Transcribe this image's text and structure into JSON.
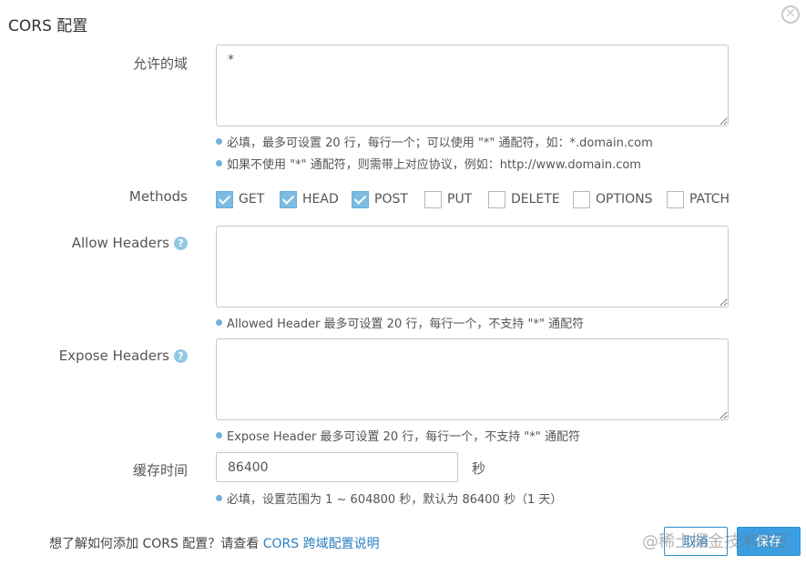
{
  "dialog": {
    "title": "CORS 配置",
    "close_icon": "✕"
  },
  "origins": {
    "label": "允许的域",
    "value": "*",
    "hints": [
      "必填，最多可设置 20 行，每行一个；可以使用 \"*\" 通配符，如：*.domain.com",
      "如果不使用 \"*\" 通配符，则需带上对应协议，例如：http://www.domain.com"
    ]
  },
  "methods": {
    "label": "Methods",
    "options": [
      {
        "name": "GET",
        "checked": true
      },
      {
        "name": "HEAD",
        "checked": true
      },
      {
        "name": "POST",
        "checked": true
      },
      {
        "name": "PUT",
        "checked": false
      },
      {
        "name": "DELETE",
        "checked": false
      },
      {
        "name": "OPTIONS",
        "checked": false
      },
      {
        "name": "PATCH",
        "checked": false
      }
    ]
  },
  "allow_headers": {
    "label": "Allow Headers",
    "help": "?",
    "value": "",
    "hint": "Allowed Header 最多可设置 20 行，每行一个，不支持 \"*\" 通配符"
  },
  "expose_headers": {
    "label": "Expose Headers",
    "help": "?",
    "value": "",
    "hint": "Expose Header 最多可设置 20 行，每行一个，不支持 \"*\" 通配符"
  },
  "cache": {
    "label": "缓存时间",
    "value": "86400",
    "unit": "秒",
    "hint": "必填，设置范围为 1 ~ 604800 秒，默认为 86400 秒（1 天）"
  },
  "footer": {
    "text": "想了解如何添加 CORS 配置？请查看 ",
    "link_text": "CORS 跨域配置说明",
    "cancel_label": "取消",
    "save_label": "保存"
  },
  "watermark": "@稀土掘金技术社区",
  "colors": {
    "accent": "#3a9ee0",
    "checkbox_checked": "#7cbce0",
    "hint_dot": "#6fb3d8",
    "link": "#2a7fc1"
  }
}
